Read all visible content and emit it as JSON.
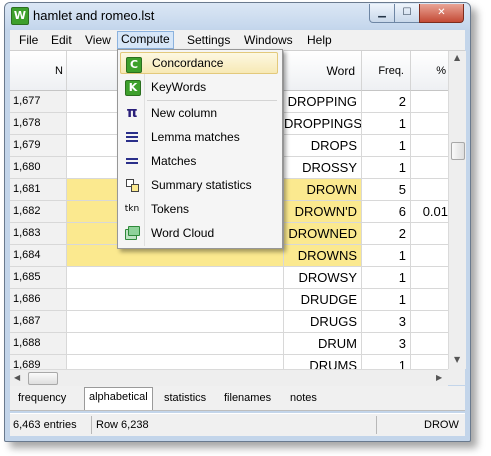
{
  "window": {
    "title": "hamlet and romeo.lst"
  },
  "menu": [
    "File",
    "Edit",
    "View",
    "Compute",
    "Settings",
    "Windows",
    "Help"
  ],
  "dropdown": {
    "items": [
      {
        "label": "Concordance",
        "icon": "concordance-icon"
      },
      {
        "label": "KeyWords",
        "icon": "keywords-icon"
      },
      {
        "label": "New column",
        "icon": "pi-icon"
      },
      {
        "label": "Lemma matches",
        "icon": "lemma-matches-icon"
      },
      {
        "label": "Matches",
        "icon": "matches-icon"
      },
      {
        "label": "Summary statistics",
        "icon": "summary-statistics-icon"
      },
      {
        "label": "Tokens",
        "icon": "tokens-icon",
        "glyph": "tkn"
      },
      {
        "label": "Word Cloud",
        "icon": "word-cloud-icon"
      }
    ]
  },
  "table": {
    "columns": {
      "n": "N",
      "word": "Word",
      "freq": "Freq.",
      "pct": "%"
    },
    "rows": [
      {
        "n": "1,677",
        "word": "DROPPING",
        "freq": "2",
        "pct": "",
        "highlight": false
      },
      {
        "n": "1,678",
        "word": "DROPPINGS",
        "freq": "1",
        "pct": "",
        "highlight": false
      },
      {
        "n": "1,679",
        "word": "DROPS",
        "freq": "1",
        "pct": "",
        "highlight": false
      },
      {
        "n": "1,680",
        "word": "DROSSY",
        "freq": "1",
        "pct": "",
        "highlight": false
      },
      {
        "n": "1,681",
        "word": "DROWN",
        "freq": "5",
        "pct": "",
        "highlight": true
      },
      {
        "n": "1,682",
        "word": "DROWN'D",
        "freq": "6",
        "pct": "0.01",
        "highlight": true
      },
      {
        "n": "1,683",
        "word": "DROWNED",
        "freq": "2",
        "pct": "",
        "highlight": true
      },
      {
        "n": "1,684",
        "word": "DROWNS",
        "freq": "1",
        "pct": "",
        "highlight": true
      },
      {
        "n": "1,685",
        "word": "DROWSY",
        "freq": "1",
        "pct": "",
        "highlight": false
      },
      {
        "n": "1,686",
        "word": "DRUDGE",
        "freq": "1",
        "pct": "",
        "highlight": false
      },
      {
        "n": "1,687",
        "word": "DRUGS",
        "freq": "3",
        "pct": "",
        "highlight": false
      },
      {
        "n": "1,688",
        "word": "DRUM",
        "freq": "3",
        "pct": "",
        "highlight": false
      },
      {
        "n": "1,689",
        "word": "DRUMS",
        "freq": "1",
        "pct": "",
        "highlight": false
      }
    ]
  },
  "tabs": [
    "frequency",
    "alphabetical",
    "statistics",
    "filenames",
    "notes"
  ],
  "active_tab": "alphabetical",
  "status": {
    "entries": "6,463 entries",
    "row": "Row 6,238",
    "word": "DROW"
  },
  "colors": {
    "highlight": "#fbe98f",
    "menu_open": "#d6e6f8",
    "titlebar": "#c4d6ec"
  }
}
